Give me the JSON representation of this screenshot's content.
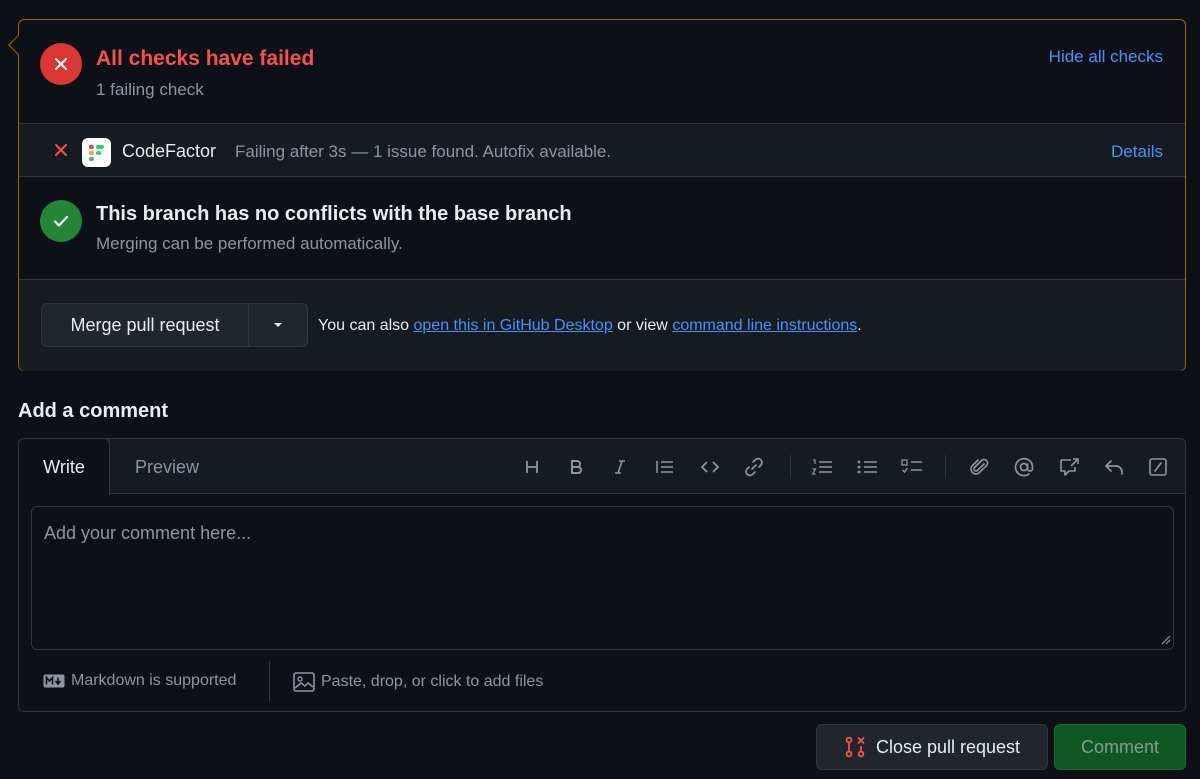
{
  "checks": {
    "title": "All checks have failed",
    "subtitle": "1 failing check",
    "hide_link": "Hide all checks",
    "items": [
      {
        "name": "CodeFactor",
        "description": "Failing after 3s — 1 issue found. Autofix available.",
        "details_link": "Details",
        "status": "failed"
      }
    ]
  },
  "conflicts": {
    "title": "This branch has no conflicts with the base branch",
    "subtitle": "Merging can be performed automatically."
  },
  "merge": {
    "button_label": "Merge pull request",
    "hint_prefix": "You can also",
    "desktop_link": "open this in GitHub Desktop",
    "hint_middle": "or view",
    "cli_link": "command line instructions",
    "hint_suffix": "."
  },
  "comment": {
    "heading": "Add a comment",
    "tabs": {
      "write": "Write",
      "preview": "Preview"
    },
    "placeholder": "Add your comment here...",
    "toolbar": [
      "heading-icon",
      "bold-icon",
      "italic-icon",
      "quote-icon",
      "code-icon",
      "link-icon",
      "ordered-list-icon",
      "unordered-list-icon",
      "task-list-icon",
      "attach-icon",
      "mention-icon",
      "reference-icon",
      "reply-icon",
      "slash-command-icon"
    ],
    "markdown_note": "Markdown is supported",
    "files_note": "Paste, drop, or click to add files"
  },
  "actions": {
    "close_label": "Close pull request",
    "comment_label": "Comment"
  },
  "colors": {
    "fail": "#da3633",
    "success": "#238636",
    "link": "#4493f8",
    "warning_border": "#9e6a03"
  }
}
